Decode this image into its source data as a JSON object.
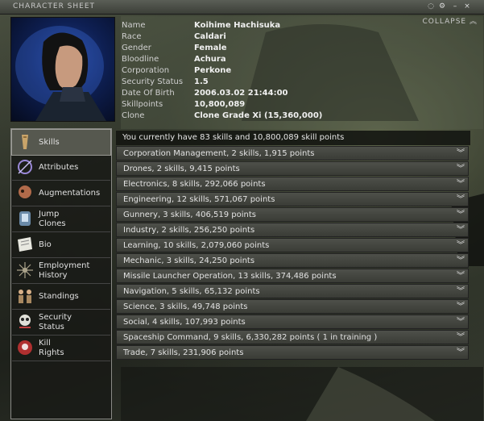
{
  "window": {
    "title": "CHARACTER SHEET",
    "collapse_label": "COLLAPSE"
  },
  "character": {
    "rows": [
      {
        "label": "Name",
        "value": "Koihime Hachisuka"
      },
      {
        "label": "Race",
        "value": "Caldari"
      },
      {
        "label": "Gender",
        "value": "Female"
      },
      {
        "label": "Bloodline",
        "value": "Achura"
      },
      {
        "label": "Corporation",
        "value": "Perkone"
      },
      {
        "label": "Security Status",
        "value": "1.5"
      },
      {
        "label": "Date Of Birth",
        "value": "2006.03.02 21:44:00"
      },
      {
        "label": "Skillpoints",
        "value": "10,800,089"
      },
      {
        "label": "Clone",
        "value": "Clone Grade Xi (15,360,000)"
      }
    ]
  },
  "sidebar": {
    "items": [
      {
        "label": "Skills",
        "icon": "skills-icon",
        "active": true
      },
      {
        "label": "Attributes",
        "icon": "attributes-icon"
      },
      {
        "label": "Augmentations",
        "icon": "augmentations-icon"
      },
      {
        "label": "Jump\nClones",
        "icon": "jump-clones-icon"
      },
      {
        "label": "Bio",
        "icon": "bio-icon"
      },
      {
        "label": "Employment\nHistory",
        "icon": "employment-history-icon"
      },
      {
        "label": "Standings",
        "icon": "standings-icon"
      },
      {
        "label": "Security\nStatus",
        "icon": "security-status-icon"
      },
      {
        "label": "Kill\nRights",
        "icon": "kill-rights-icon"
      }
    ]
  },
  "skills": {
    "summary": "You currently have 83 skills and 10,800,089 skill points",
    "groups": [
      "Corporation Management, 2 skills, 1,915 points",
      "Drones, 2 skills, 9,415 points",
      "Electronics, 8 skills, 292,066 points",
      "Engineering, 12 skills, 571,067 points",
      "Gunnery, 3 skills, 406,519 points",
      "Industry, 2 skills, 256,250 points",
      "Learning, 10 skills, 2,079,060 points",
      "Mechanic, 3 skills, 24,250 points",
      "Missile Launcher Operation, 13 skills, 374,486 points",
      "Navigation, 5 skills, 65,132 points",
      "Science, 3 skills, 49,748 points",
      "Social, 4 skills, 107,993 points",
      "Spaceship Command, 9 skills, 6,330,282 points ( 1 in training )",
      "Trade, 7 skills, 231,906 points"
    ]
  },
  "colors": {
    "portrait_bg": "#0e1f52",
    "row_bg": "#4e504a",
    "active_nav": "#56584f"
  }
}
